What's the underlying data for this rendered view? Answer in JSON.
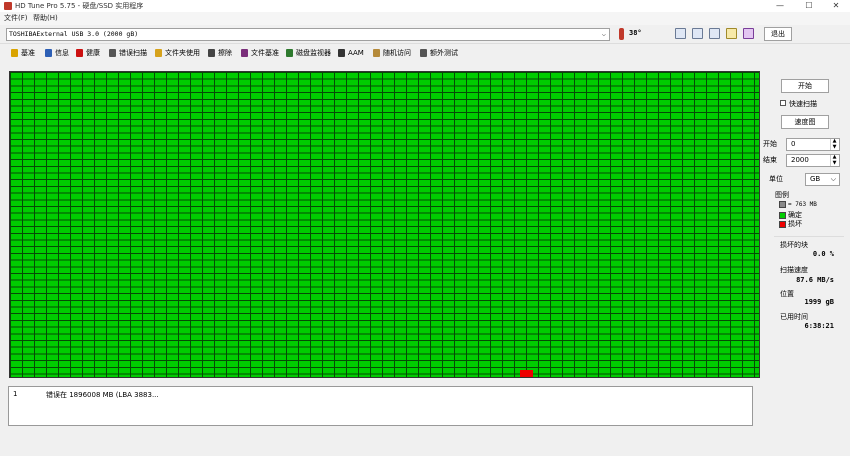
{
  "window": {
    "title": "HD Tune Pro 5.75 - 硬盘/SSD 实用程序",
    "minimize": "—",
    "maximize": "☐",
    "close": "✕"
  },
  "menu": [
    "文件(F)",
    "帮助(H)"
  ],
  "drive": {
    "selected": "TOSHIBAExternal USB 3.0 (2000 gB)",
    "temperature": "38°"
  },
  "toolbar": {
    "exit_label": "退出",
    "icons": [
      "copy-icon",
      "copy-alt-icon",
      "camera-icon",
      "link-icon",
      "download-icon"
    ]
  },
  "tabs": [
    {
      "label": "基准",
      "icon": "bulb-icon",
      "color": "#d9a300"
    },
    {
      "label": "信息",
      "icon": "info-icon",
      "color": "#2d5fb5"
    },
    {
      "label": "健康",
      "icon": "health-cross-icon",
      "color": "#cc1111"
    },
    {
      "label": "错误扫描",
      "icon": "magnifier-icon",
      "color": "#555555"
    },
    {
      "label": "文件夹使用",
      "icon": "folder-icon",
      "color": "#d6a21c"
    },
    {
      "label": "擦除",
      "icon": "trash-icon",
      "color": "#444444"
    },
    {
      "label": "文件基准",
      "icon": "file-benchmark-icon",
      "color": "#7a2e7a"
    },
    {
      "label": "磁盘监视器",
      "icon": "monitor-icon",
      "color": "#2e7a2e"
    },
    {
      "label": "AAM",
      "icon": "speaker-icon",
      "color": "#333333"
    },
    {
      "label": "随机访问",
      "icon": "random-access-icon",
      "color": "#b58a3a"
    },
    {
      "label": "额外测试",
      "icon": "extra-tests-icon",
      "color": "#555555"
    }
  ],
  "scan": {
    "cell_color": "#00cc00",
    "bad_color": "#ee0000"
  },
  "log": {
    "entries": [
      {
        "index": "1",
        "message": "错误在 1896008 MB (LBA 3883..."
      }
    ]
  },
  "side": {
    "start_button": "开始",
    "quick_scan_label": "快速扫描",
    "speed_map_button": "速度图",
    "start_label": "开始",
    "start_value": "0",
    "end_label": "结束",
    "end_value": "2000",
    "unit_label": "单位",
    "unit_value": "GB",
    "legend_title": "图例",
    "legend_block": "= 763 MB",
    "legend_ok": "确定",
    "legend_bad": "损坏",
    "bad_blocks_label": "损坏的块",
    "bad_blocks_value": "0.0 %",
    "scan_speed_label": "扫描速度",
    "scan_speed_value": "87.6 MB/s",
    "position_label": "位置",
    "position_value": "1999 gB",
    "elapsed_label": "已用时间",
    "elapsed_value": "6:38:21"
  }
}
